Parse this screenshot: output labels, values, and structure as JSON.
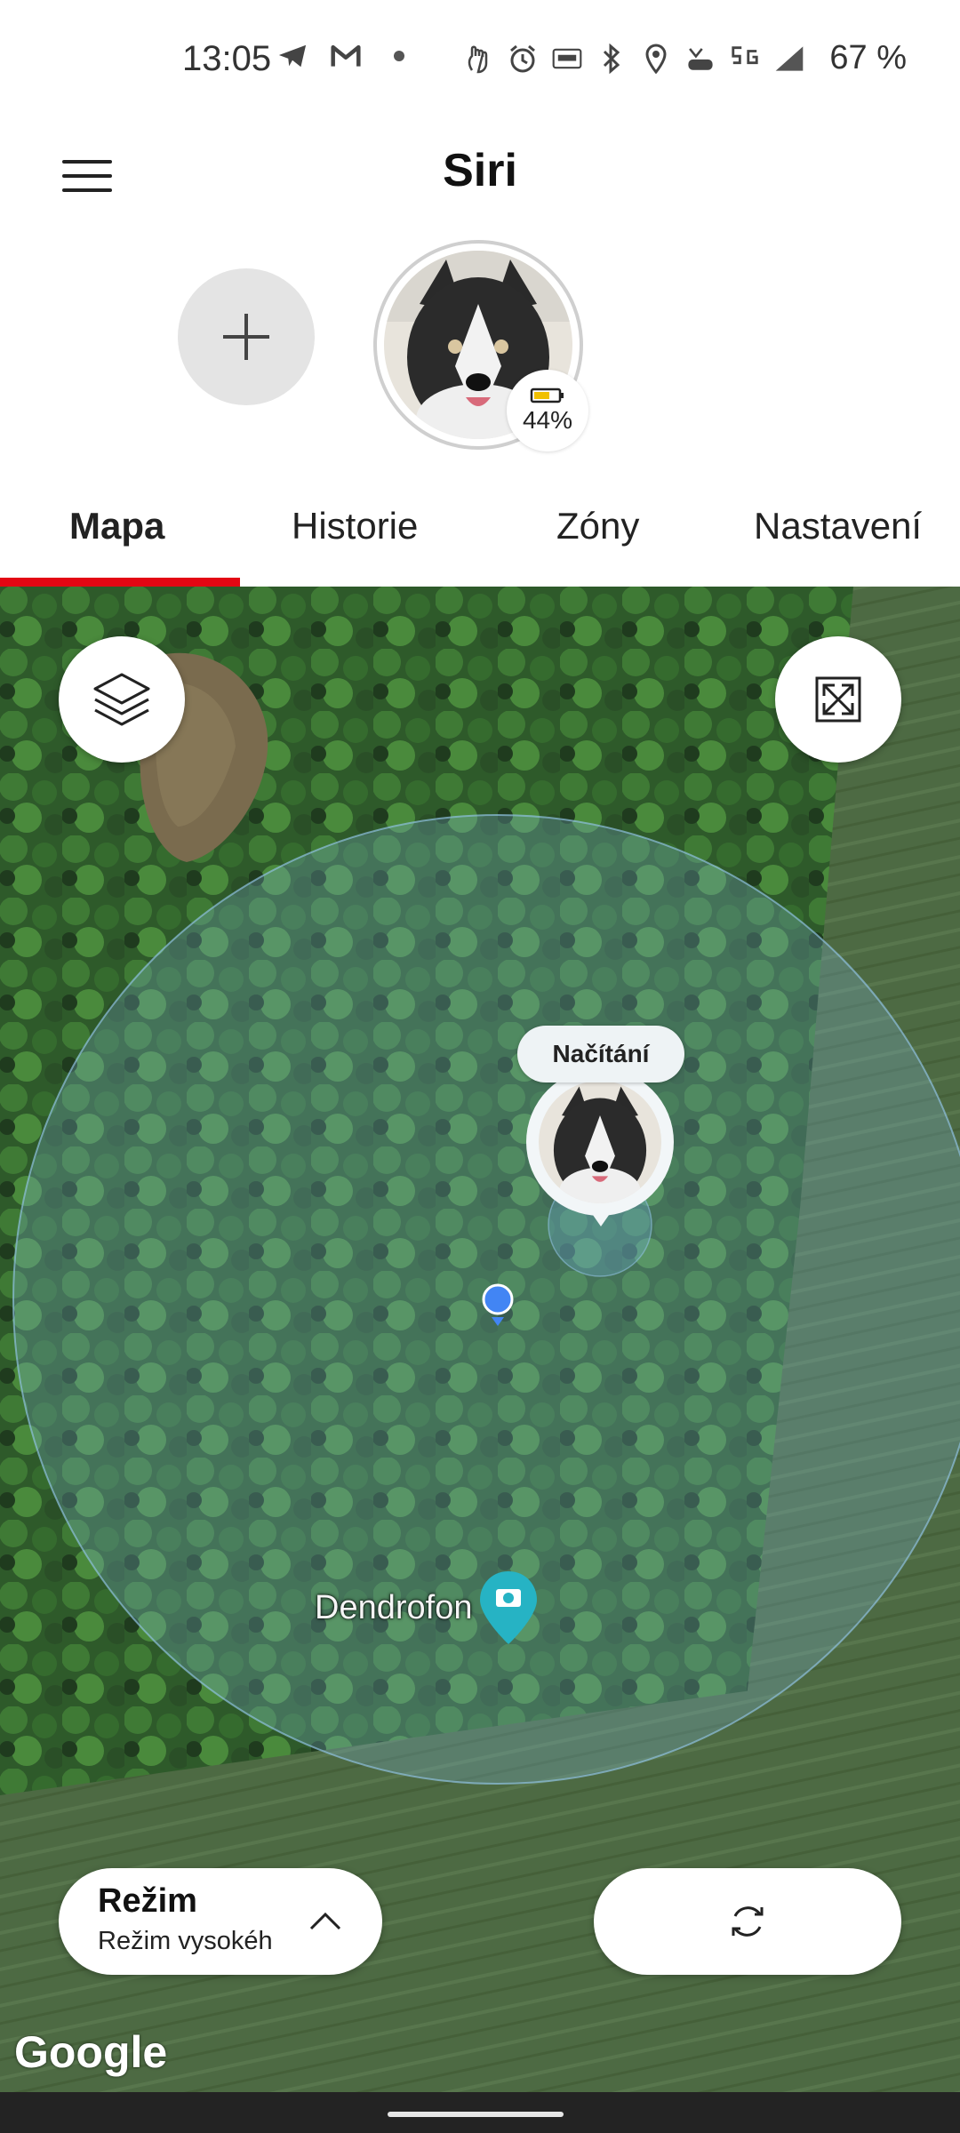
{
  "status_bar": {
    "time": "13:05",
    "left_icons": [
      "telegram-icon",
      "gmail-icon",
      "dot-icon"
    ],
    "right_icons": [
      "hand-icon",
      "alarm-icon",
      "auto-hz-icon",
      "bluetooth-icon",
      "location-icon",
      "volte-icon",
      "5g-icon",
      "signal-icon"
    ],
    "battery_percent": "67 %"
  },
  "header": {
    "title": "Siri"
  },
  "pet": {
    "battery": "44%"
  },
  "tabs": [
    {
      "label": "Mapa",
      "active": true
    },
    {
      "label": "Historie",
      "active": false
    },
    {
      "label": "Zóny",
      "active": false
    },
    {
      "label": "Nastavení",
      "active": false
    }
  ],
  "map": {
    "loading_label": "Načítání",
    "poi_label": "Dendrofon",
    "provider": "Google",
    "accent_color": "#e30613"
  },
  "mode": {
    "title": "Režim",
    "subtitle": "Režim vysokéh"
  }
}
